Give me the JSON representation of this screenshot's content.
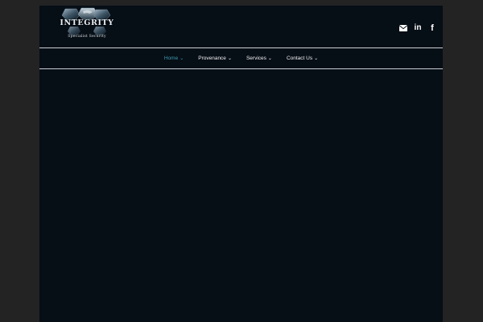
{
  "brand": {
    "name": "INTEGRITY",
    "tagline": "Specialist Security"
  },
  "social": [
    {
      "icon": "envelope-icon"
    },
    {
      "icon": "linkedin-icon",
      "label": "in"
    },
    {
      "icon": "facebook-icon",
      "label": "f"
    }
  ],
  "nav": {
    "items": [
      {
        "label": "Home",
        "active": true
      },
      {
        "label": "Provenance",
        "active": false
      },
      {
        "label": "Services",
        "active": false
      },
      {
        "label": "Contact Us",
        "active": false
      }
    ]
  },
  "colors": {
    "background": "#232323",
    "page": "#060e16",
    "accent": "#3f9bb0",
    "nav_text": "#f2f2f2"
  }
}
